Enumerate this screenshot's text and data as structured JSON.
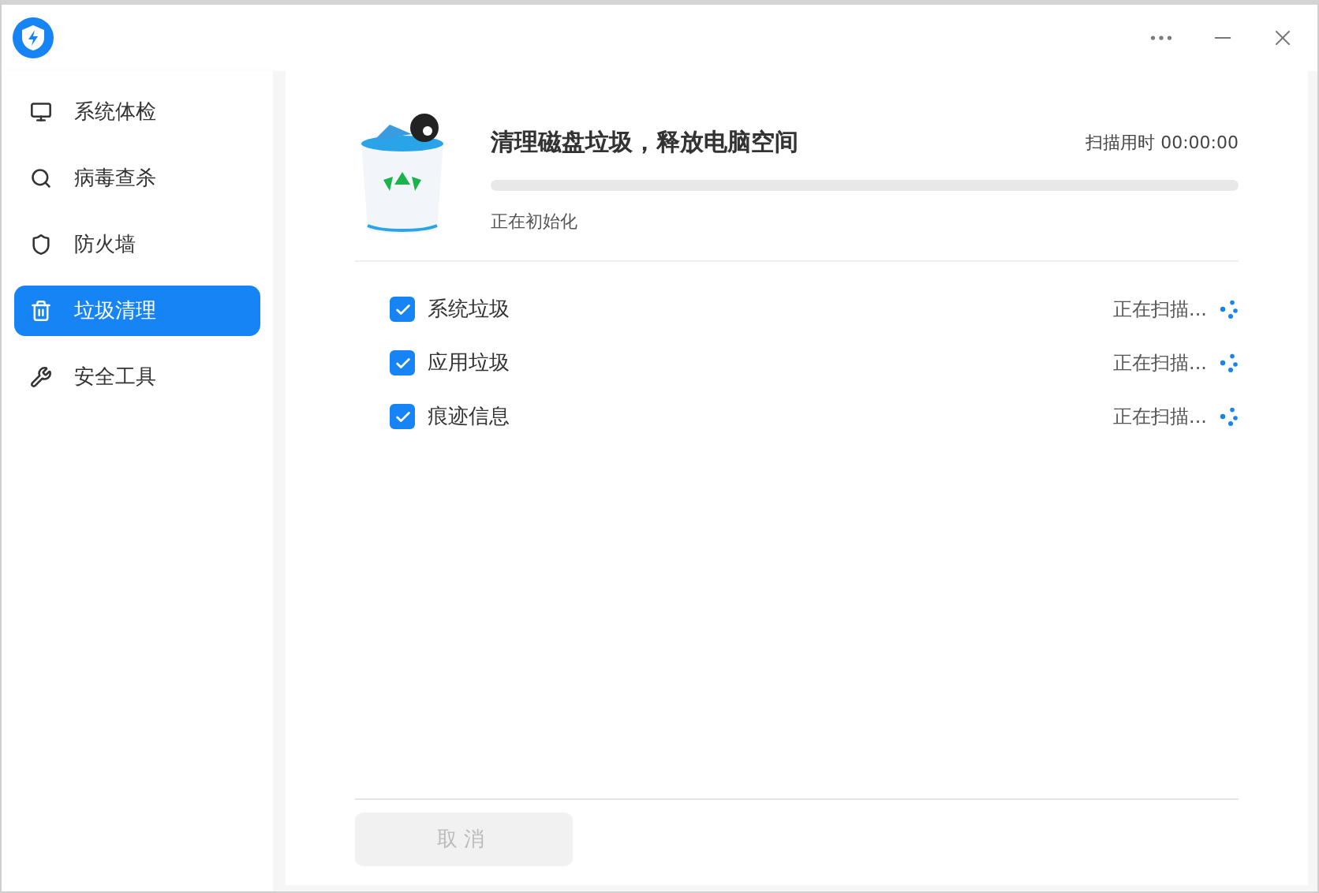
{
  "window": {
    "controls": [
      {
        "kind": "more"
      },
      {
        "kind": "minimize"
      },
      {
        "kind": "close"
      }
    ]
  },
  "sidebar": {
    "items": [
      {
        "label": "系统体检",
        "selected": false
      },
      {
        "label": "病毒查杀",
        "selected": false
      },
      {
        "label": "防火墙",
        "selected": false
      },
      {
        "label": "垃圾清理",
        "selected": true
      },
      {
        "label": "安全工具",
        "selected": false
      }
    ]
  },
  "header": {
    "title": "清理磁盘垃圾，释放电脑空间",
    "timer": "扫描用时 00:00:00",
    "progress": {
      "level": 0
    },
    "status": "正在初始化"
  },
  "items": [
    {
      "label": "系统垃圾",
      "checked": true,
      "status": "正在扫描..."
    },
    {
      "label": "应用垃圾",
      "checked": true,
      "status": "正在扫描..."
    },
    {
      "label": "痕迹信息",
      "checked": true,
      "status": "正在扫描..."
    }
  ],
  "footer": {
    "button": {
      "label": "取消",
      "disabled": true
    }
  }
}
